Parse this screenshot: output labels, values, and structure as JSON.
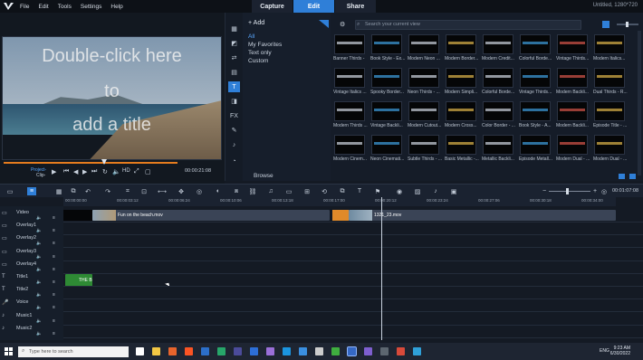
{
  "menu": [
    "File",
    "Edit",
    "Tools",
    "Settings",
    "Help"
  ],
  "tabs": [
    "Capture",
    "Edit",
    "Share"
  ],
  "title_right": "Untitled, 1280*720",
  "preview": {
    "overlay_lines": [
      "Double-click here",
      "to",
      "add a title"
    ],
    "mode_project": "Project-",
    "mode_clip": "Clip-",
    "hd": "HD",
    "timecode": "00:00:21:08"
  },
  "library": {
    "add": "Add",
    "categories": [
      "All",
      "My Favorites",
      "Text only",
      "Custom"
    ],
    "browse": "Browse",
    "search_placeholder": "Search your current view",
    "titles": [
      "Banner Thirds -",
      "Book Style - Ex...",
      "Modern Neon ...",
      "Modern Border...",
      "Modern Credit...",
      "Colorful Borde...",
      "Vintage Thirds...",
      "Modern Italics...",
      "Vintage Italics ...",
      "Spooky Border...",
      "Neon Thirds - ...",
      "Modern Simpli...",
      "Colorful Borde...",
      "Vintage Thirds...",
      "Modern Backli...",
      "Dual Thirds - R...",
      "Modern Thirds ...",
      "Vintage Backli...",
      "Modern Cutout...",
      "Modern Cross...",
      "Color Border - ...",
      "Book Style - A...",
      "Modern Backli...",
      "Episode Title - ...",
      "Modern Cinem...",
      "Neon Cinemati...",
      "Subtle Thirds - ...",
      "Basic Metallic -...",
      "Metallic Backli...",
      "Episode Metall...",
      "Modern Dual - ...",
      "Modern Dual - ..."
    ]
  },
  "timeline": {
    "ruler": [
      "00:00:00:00",
      "00:00:03:12",
      "00:00:06:24",
      "00:00:10:06",
      "00:00:13:18",
      "00:00:17:00",
      "00:00:20:12",
      "00:00:23:24",
      "00:00:27:06",
      "00:00:30:18",
      "00:00:34:00"
    ],
    "zoom_time": "00:01:07:08",
    "tracks": [
      "Video",
      "Overlay1",
      "Overlay2",
      "Overlay3",
      "Overlay4",
      "Title1",
      "Title2",
      "Voice",
      "Music1",
      "Music2"
    ],
    "clips": {
      "video1": "Fun on the beach.mov",
      "video2": "1321_23.mov",
      "title1": "THE B"
    }
  },
  "taskbar": {
    "search": "Type here to search",
    "time": "9:23 AM",
    "date": "6/30/2022",
    "lang": "ENG"
  },
  "colors": {
    "accent": "#2f7fd8",
    "clip_video": "#3a4456",
    "clip_title": "#2e8a34"
  }
}
